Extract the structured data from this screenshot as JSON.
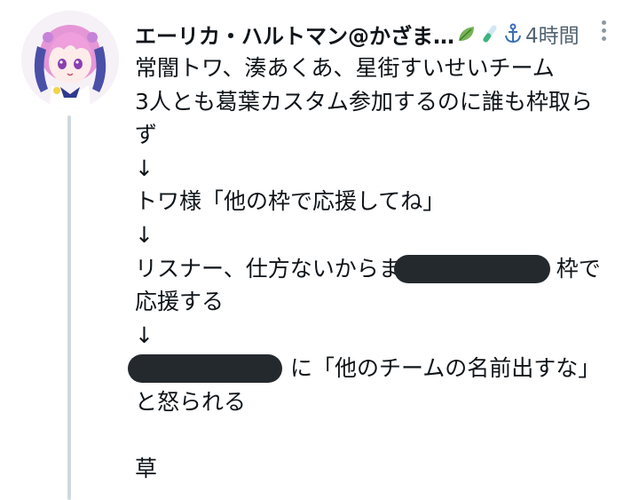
{
  "tweet": {
    "display_name": "エーリカ・ハルトマン@かざま…",
    "time": "4時間",
    "lines": [
      "常闇トワ、湊あくあ、星街すいせいチーム",
      "3人とも葛葉カスタム参加するのに誰も枠取ら",
      "ず",
      "↓",
      "トワ様「他の枠で応援してね」",
      "↓",
      "リスナー、仕方ないからま　　　　　　　枠で",
      "応援する",
      "↓",
      "　　　　　　　に「他のチームの名前出すな」",
      "と怒られる",
      "",
      "草"
    ]
  },
  "icons": [
    "leaf-icon",
    "test-tube-icon",
    "anchor-icon",
    "more-options-icon",
    "avatar"
  ],
  "colors": {
    "text": "#0f1419",
    "secondary": "#536471",
    "redaction": "#24292e",
    "thread_line": "#cfd9de"
  }
}
